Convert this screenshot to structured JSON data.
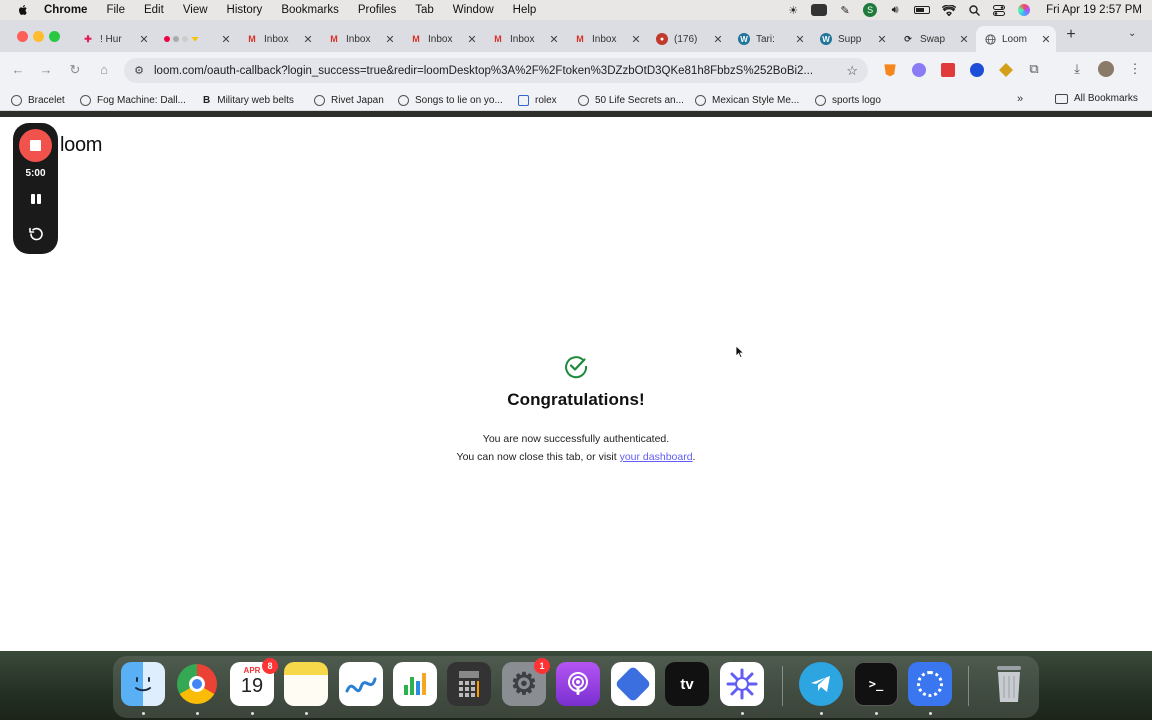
{
  "menubar": {
    "app": "Chrome",
    "items": [
      "File",
      "Edit",
      "View",
      "History",
      "Bookmarks",
      "Profiles",
      "Tab",
      "Window",
      "Help"
    ],
    "clock": "Fri Apr 19  2:57 PM"
  },
  "tabs": [
    {
      "title": "! Hur",
      "icon": "slack-icon"
    },
    {
      "title": "",
      "icon": "colored-dots-icon"
    },
    {
      "title": "Inbox",
      "icon": "gmail-icon"
    },
    {
      "title": "Inbox",
      "icon": "gmail-icon"
    },
    {
      "title": "Inbox",
      "icon": "gmail-icon"
    },
    {
      "title": "Inbox",
      "icon": "gmail-icon"
    },
    {
      "title": "Inbox",
      "icon": "gmail-icon"
    },
    {
      "title": "(176)",
      "icon": "notification-icon"
    },
    {
      "title": "Tari:",
      "icon": "wordpress-icon"
    },
    {
      "title": "Supp",
      "icon": "wordpress-icon"
    },
    {
      "title": "Swap",
      "icon": "swap-icon"
    },
    {
      "title": "Loom",
      "icon": "globe-icon",
      "active": true
    }
  ],
  "address_bar": {
    "url": "loom.com/oauth-callback?login_success=true&redir=loomDesktop%3A%2F%2Ftoken%3DZzbOtD3QKe81h8FbbzS%252BoBi2..."
  },
  "bookmarks": [
    {
      "label": "Bracelet"
    },
    {
      "label": "Fog Machine: Dall..."
    },
    {
      "label": "Military web belts",
      "prefix": "B"
    },
    {
      "label": "Rivet Japan"
    },
    {
      "label": "Songs to lie on yo..."
    },
    {
      "label": "rolex"
    },
    {
      "label": "50 Life Secrets an..."
    },
    {
      "label": "Mexican Style Me..."
    },
    {
      "label": "sports logo"
    }
  ],
  "all_bookmarks": "All Bookmarks",
  "page": {
    "logo": "loom",
    "recorder_time": "5:00",
    "heading": "Congratulations!",
    "message_line1": "You are now successfully authenticated.",
    "message_line2_prefix": "You can now close this tab, or visit ",
    "dashboard_link": "your dashboard",
    "message_line2_suffix": "."
  },
  "dock": {
    "calendar_month": "APR",
    "calendar_day": "19",
    "calendar_badge": "8",
    "settings_badge": "1"
  }
}
